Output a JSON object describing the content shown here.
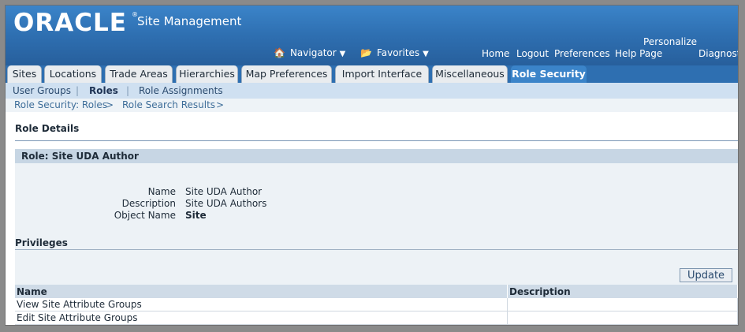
{
  "branding": {
    "logo": "ORACLE",
    "reg_mark": "®",
    "app_title": "Site Management"
  },
  "global_nav": {
    "navigator": "Navigator",
    "favorites": "Favorites",
    "home": "Home",
    "logout": "Logout",
    "preferences": "Preferences",
    "personalize_line1": "Personalize",
    "personalize_line2": "Help Page",
    "diagnostics": "Diagnost"
  },
  "tabs": [
    {
      "label": "Sites"
    },
    {
      "label": "Locations"
    },
    {
      "label": "Trade Areas"
    },
    {
      "label": "Hierarchies"
    },
    {
      "label": "Map Preferences"
    },
    {
      "label": "Import Interface"
    },
    {
      "label": "Miscellaneous"
    },
    {
      "label": "Role Security"
    }
  ],
  "subnav": {
    "user_groups": "User Groups",
    "roles": "Roles",
    "role_assignments": "Role Assignments",
    "sep": "|"
  },
  "breadcrumbs": {
    "c1": "Role Security: Roles",
    "c2": "Role Search Results",
    "sep": ">"
  },
  "section": {
    "title": "Role Details"
  },
  "role": {
    "header": "Role: Site UDA Author",
    "name_label": "Name",
    "name_value": "Site UDA Author",
    "desc_label": "Description",
    "desc_value": "Site UDA Authors",
    "object_label": "Object Name",
    "object_value": "Site"
  },
  "privileges": {
    "title": "Privileges",
    "update_label": "Update",
    "columns": [
      "Name",
      "Description"
    ],
    "rows": [
      {
        "name": "View Site Attribute Groups",
        "description": ""
      },
      {
        "name": "Edit Site Attribute Groups",
        "description": ""
      }
    ]
  },
  "colors": {
    "header_blue": "#2e6fb1",
    "active_tab": "#3b84c9",
    "subnav": "#cfe0f1"
  }
}
